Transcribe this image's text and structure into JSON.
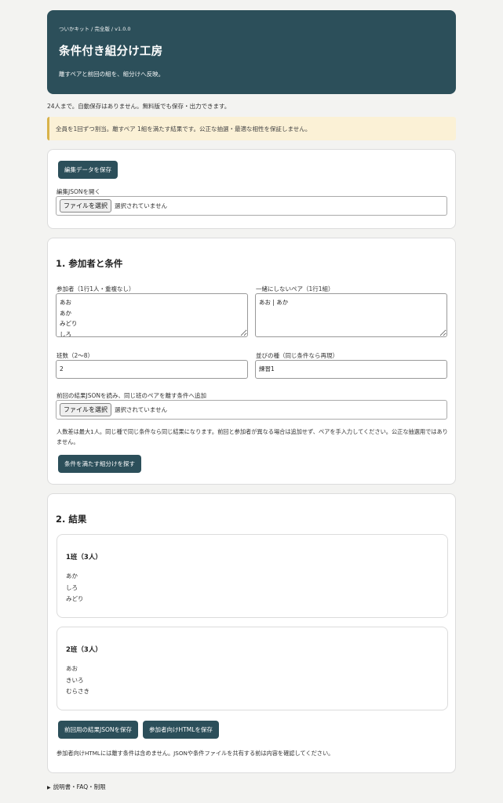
{
  "header": {
    "kicker": "ついかキット / 完全版 / v1.0.0",
    "title": "条件付き組分け工房",
    "subtitle": "離すペアと前回の組を、組分けへ反映。"
  },
  "note_line": "24人まで。自動保存はありません。無料版でも保存・出力できます。",
  "warning": "全員を1回ずつ割当。離すペア 1組を満たす結果です。公正な抽選・最適な相性を保証しません。",
  "save_section": {
    "save_button": "編集データを保存",
    "open_label": "編集JSONを開く",
    "file_button": "ファイルを選択",
    "file_none": "選択されていません"
  },
  "conditions": {
    "heading": "1. 参加者と条件",
    "participants_label": "参加者（1行1人・重複なし）",
    "participants_value": "あお\nあか\nみどり\nしろ",
    "pairs_label": "一緒にしないペア（1行1組）",
    "pairs_value": "あお | あか",
    "groups_label": "班数（2〜8）",
    "groups_value": "2",
    "seed_label": "並びの種（同じ条件なら再現）",
    "seed_value": "練習1",
    "prev_label": "前回の結果JSONを読み、同じ班のペアを離す条件へ追加",
    "file_button": "ファイルを選択",
    "file_none": "選択されていません",
    "help": "人数差は最大1人。同じ種で同じ条件なら同じ結果になります。前回と参加者が異なる場合は追加せず、ペアを手入力してください。公正な抽選用ではありません。",
    "run_button": "条件を満たす組分けを探す"
  },
  "results": {
    "heading": "2. 結果",
    "groups": [
      {
        "title": "1班（3人）",
        "members": [
          "あか",
          "しろ",
          "みどり"
        ]
      },
      {
        "title": "2班（3人）",
        "members": [
          "あお",
          "きいろ",
          "むらさき"
        ]
      }
    ],
    "save_prev_button": "前回用の結果JSONを保存",
    "save_html_button": "参加者向けHTMLを保存",
    "note": "参加者向けHTMLには離す条件は含めません。JSONや条件ファイルを共有する前は内容を確認してください。"
  },
  "details": {
    "icon": "triangle-right-icon",
    "label": "説明書・FAQ・制限"
  }
}
